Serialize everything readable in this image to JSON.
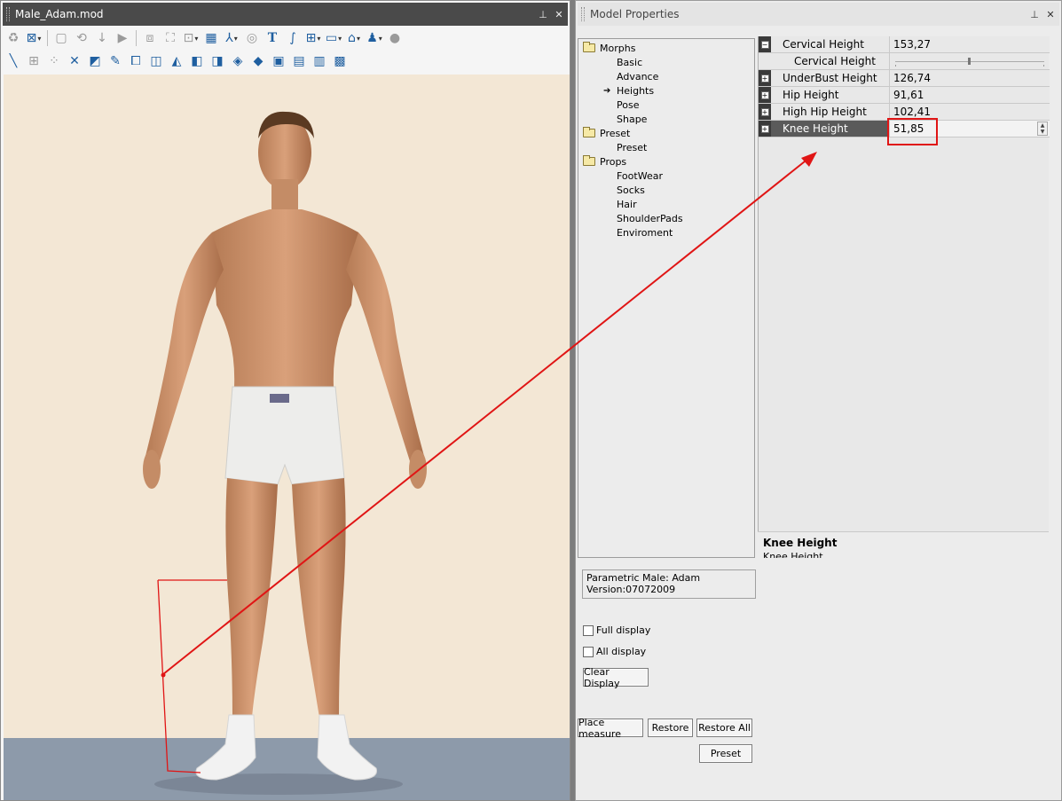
{
  "left_window": {
    "title": "Male_Adam.mod",
    "pin_icon": "pin-icon",
    "close_icon": "close-icon"
  },
  "toolbar_row1": [
    "recycle-icon",
    "tree-icon",
    "doc-icon",
    "refresh-icon",
    "down-arrow-icon",
    "play-icon",
    "frame-icon",
    "frame-select-icon",
    "fit-icon",
    "checker-icon",
    "axis-icon",
    "camera-icon",
    "text-icon",
    "curve-icon",
    "add-icon",
    "monitor-icon",
    "folder-open-icon",
    "users-icon",
    "sphere-icon"
  ],
  "toolbar_row2": [
    "measure-icon",
    "grid-icon",
    "grid-dots-icon",
    "cross-icon",
    "select-icon",
    "edit-icon",
    "frame-icon",
    "cube-icon",
    "cube-alt-icon",
    "view-icon",
    "view-alt-icon",
    "plane-icon",
    "plane-alt-icon",
    "mesh-icon",
    "mesh-alt-icon",
    "mesh-dots-icon",
    "mesh-grid-icon"
  ],
  "right_window": {
    "title": "Model Properties",
    "pin_icon": "pin-icon",
    "close_icon": "close-icon"
  },
  "tree": {
    "morphs": "Morphs",
    "basic": "Basic",
    "advance": "Advance",
    "heights": "Heights",
    "pose": "Pose",
    "shape": "Shape",
    "preset_folder": "Preset",
    "preset_item": "Preset",
    "props": "Props",
    "footwear": "FootWear",
    "socks": "Socks",
    "hair": "Hair",
    "shoulderpads": "ShoulderPads",
    "enviroment": "Enviroment"
  },
  "properties": {
    "cervical_name": "Cervical Height",
    "cervical_value": "153,27",
    "cervical_sub": "Cervical Height",
    "cervical_slider_fraction": 0.49,
    "underbust_name": "UnderBust Height",
    "underbust_value": "126,74",
    "hip_name": "Hip Height",
    "hip_value": "91,61",
    "highhip_name": "High Hip Height",
    "highhip_value": "102,41",
    "knee_name": "Knee Height",
    "knee_value": "51,85"
  },
  "description": {
    "title": "Knee Height",
    "text": "Knee Height"
  },
  "model_info": {
    "line1": "Parametric Male: Adam",
    "line2": "Version:07072009"
  },
  "checks": {
    "full_display": "Full display",
    "all_display": "All display"
  },
  "buttons": {
    "clear_display": "Clear Display",
    "place_measure": "Place measure",
    "restore": "Restore",
    "restore_all": "Restore All",
    "preset": "Preset"
  },
  "colors": {
    "annotation_red": "#e01515",
    "viewport_bg": "#f3e7d5",
    "floor": "#8d9aaa"
  }
}
